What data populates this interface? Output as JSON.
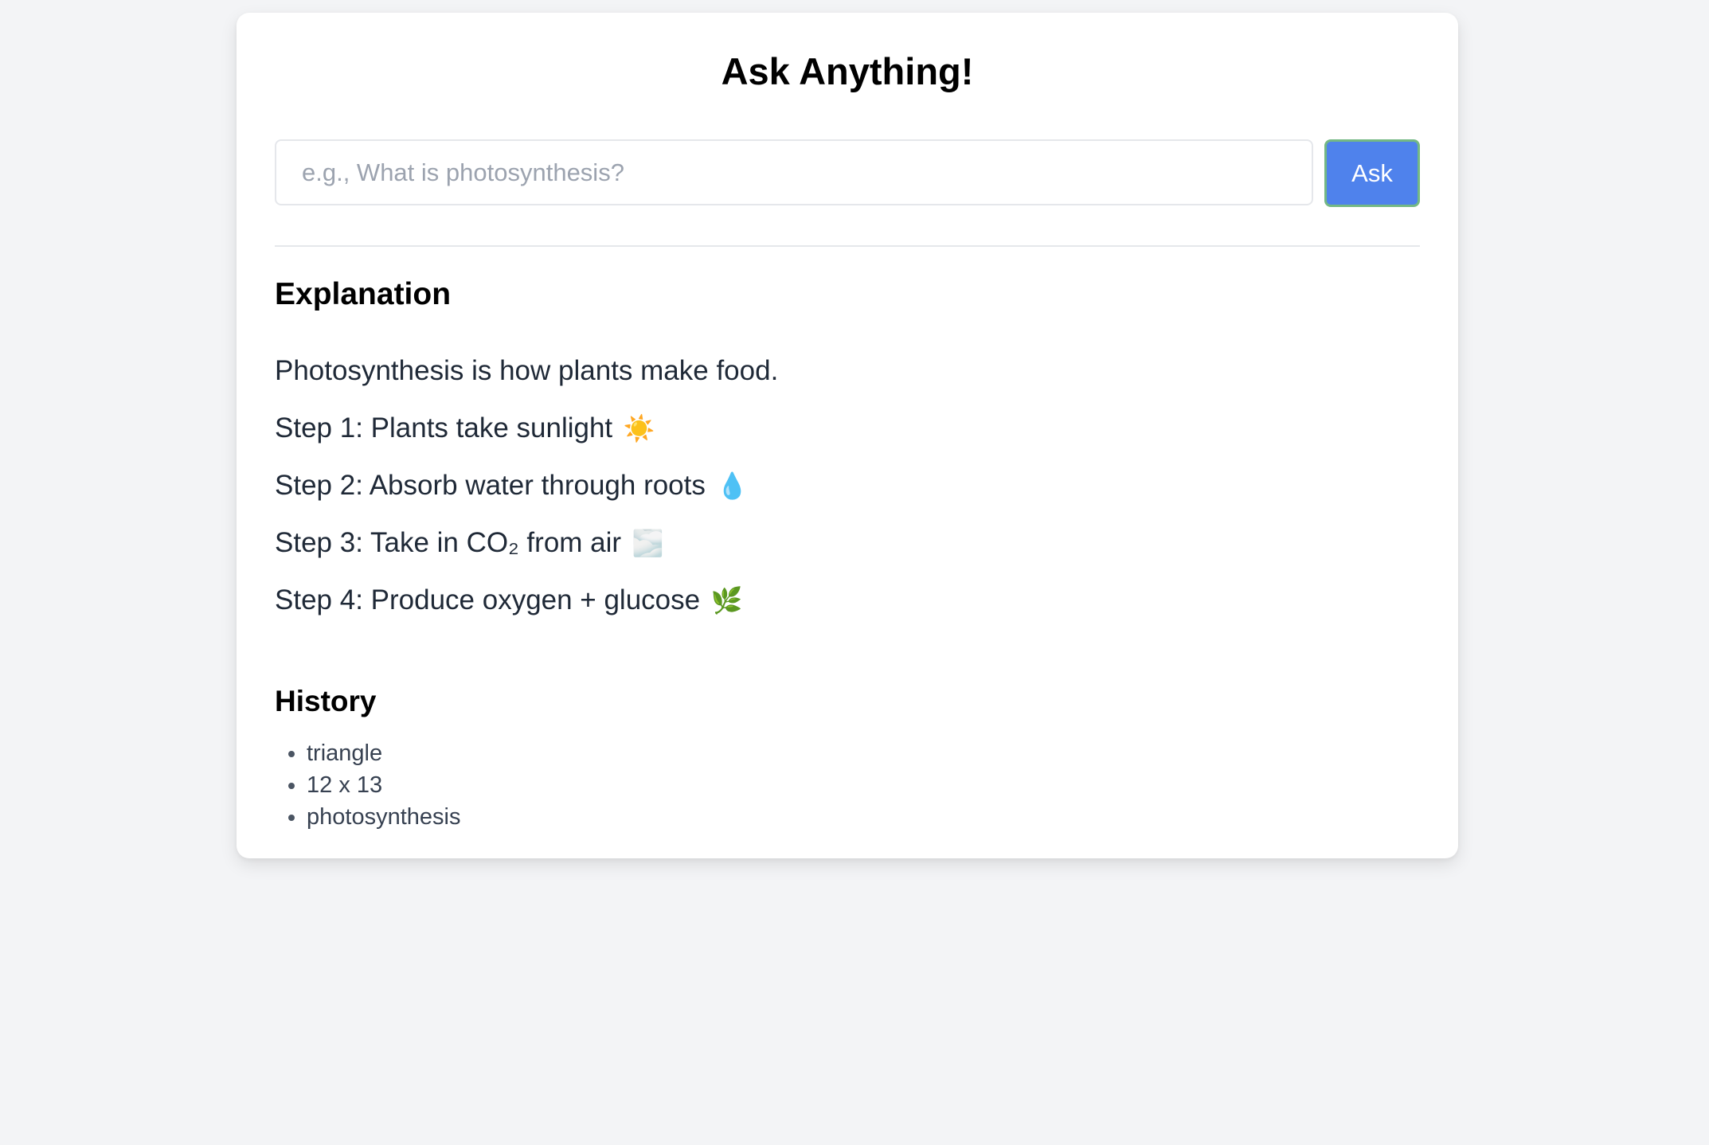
{
  "app": {
    "title": "Ask Anything!"
  },
  "ask": {
    "input_value": "",
    "placeholder": "e.g., What is photosynthesis?",
    "button_label": "Ask"
  },
  "explanation": {
    "heading": "Explanation",
    "lines": [
      {
        "text": "Photosynthesis is how plants make food.",
        "emoji": ""
      },
      {
        "text": "Step 1: Plants take sunlight",
        "emoji": "☀️"
      },
      {
        "text": "Step 2: Absorb water through roots",
        "emoji": "💧"
      },
      {
        "text": "Step 3: Take in CO₂ from air",
        "emoji": "🌫️"
      },
      {
        "text": "Step 4: Produce oxygen + glucose",
        "emoji": "🌿"
      }
    ]
  },
  "history": {
    "heading": "History",
    "items": [
      "triangle",
      "12 x 13",
      "photosynthesis"
    ]
  },
  "colors": {
    "page_background": "#f3f4f6",
    "card_background": "#ffffff",
    "button_background": "#4f82ec",
    "button_border": "#74b884",
    "divider": "#e5e7eb"
  }
}
